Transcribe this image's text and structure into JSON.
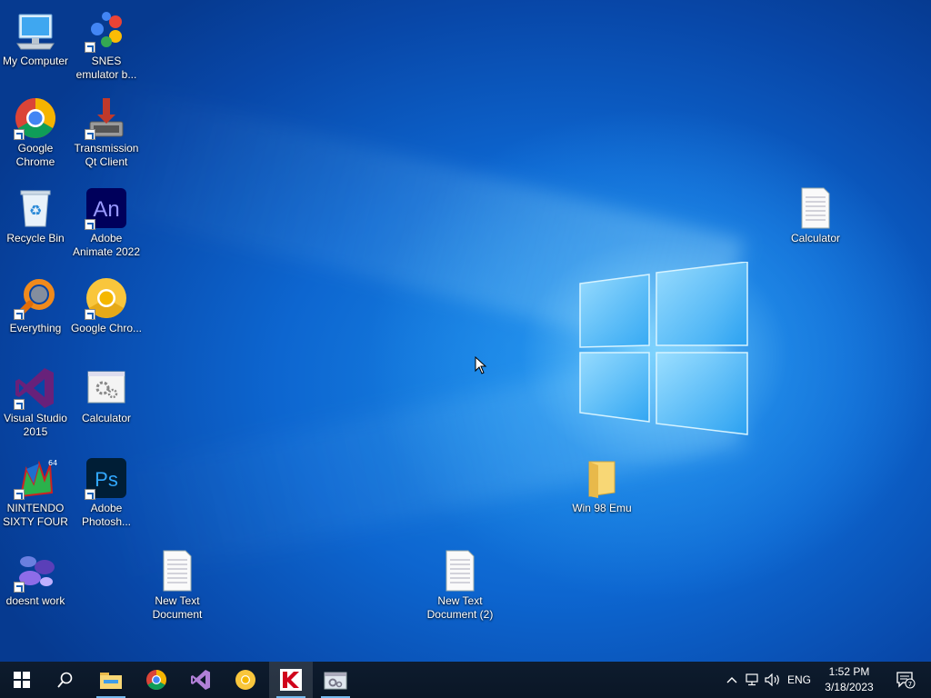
{
  "desktop": {
    "icons": {
      "my_computer": "My Computer",
      "snes": "SNES emulator b...",
      "chrome": "Google Chrome",
      "transmission": "Transmission Qt Client",
      "recycle_bin": "Recycle Bin",
      "animate": "Adobe Animate 2022",
      "everything": "Everything",
      "chrome_canary": "Google Chro...",
      "visual_studio": "Visual Studio 2015",
      "calculator_left": "Calculator",
      "nintendo": "NINTENDO SIXTY FOUR",
      "photoshop": "Adobe Photosh...",
      "doesnt_work": "doesnt work",
      "new_text_doc": "New Text Document",
      "new_text_doc2": "New Text Document (2)",
      "win98": "Win 98 Emu",
      "calculator_right": "Calculator"
    },
    "animate_glyph": "An",
    "photoshop_glyph": "Ps"
  },
  "taskbar": {
    "pinned": [
      "start-icon",
      "search-icon",
      "file-explorer-icon",
      "chrome-icon",
      "visual-studio-icon",
      "chrome-canary-icon",
      "kaspersky-icon",
      "app-window-icon"
    ],
    "tray": {
      "language": "ENG",
      "time": "1:52 PM",
      "date": "3/18/2023",
      "notification_count": "7"
    }
  },
  "colors": {
    "taskbar_bg": "#0c1a2b",
    "desktop_blue": "#0d66d0",
    "vs_purple": "#68217a",
    "animate_bg": "#00005b",
    "photoshop_bg": "#001e36"
  }
}
